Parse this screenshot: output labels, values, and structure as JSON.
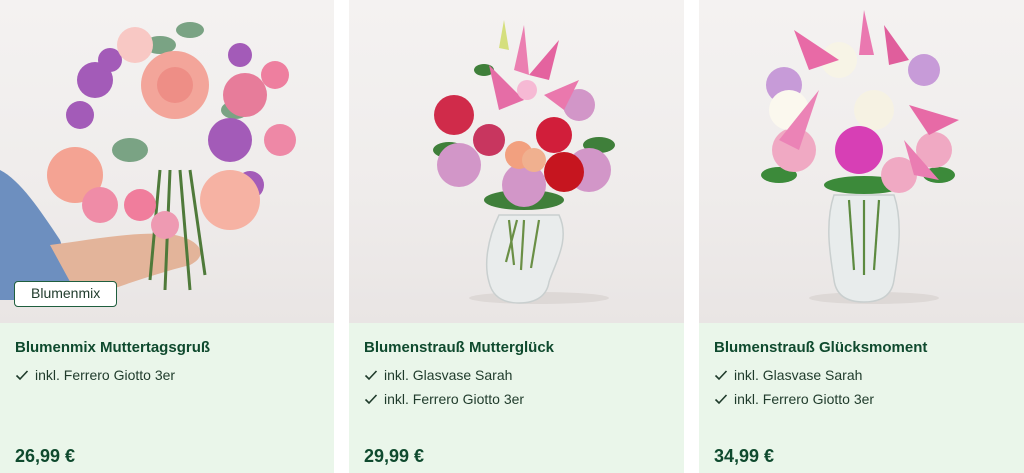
{
  "products": [
    {
      "badge": "Blumenmix",
      "title": "Blumenmix Muttertagsgruß",
      "features": [
        "inkl. Ferrero Giotto 3er"
      ],
      "price": "26,99 €",
      "image": "bouquet-held-in-hand"
    },
    {
      "title": "Blumenstrauß Mutterglück",
      "features": [
        "inkl. Glasvase Sarah",
        "inkl. Ferrero Giotto 3er"
      ],
      "price": "29,99 €",
      "image": "bouquet-in-glass-vase"
    },
    {
      "title": "Blumenstrauß Glücksmoment",
      "features": [
        "inkl. Glasvase Sarah",
        "inkl. Ferrero Giotto 3er"
      ],
      "price": "34,99 €",
      "image": "bouquet-in-glass-vase"
    }
  ],
  "colors": {
    "card_background": "#eaf6ea",
    "title_green": "#0f4a2e",
    "badge_border": "#1f5e3e"
  }
}
